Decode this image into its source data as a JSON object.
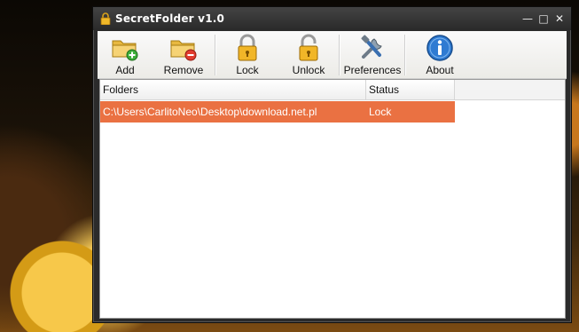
{
  "window": {
    "title": "SecretFolder v1.0",
    "controls": {
      "minimize": "—",
      "maximize": "□",
      "close": "✕"
    }
  },
  "toolbar": {
    "buttons": [
      {
        "label": "Add",
        "icon": "folder-add-icon"
      },
      {
        "label": "Remove",
        "icon": "folder-remove-icon"
      },
      {
        "label": "Lock",
        "icon": "lock-icon"
      },
      {
        "label": "Unlock",
        "icon": "unlock-icon"
      },
      {
        "label": "Preferences",
        "icon": "tools-icon"
      },
      {
        "label": "About",
        "icon": "info-icon"
      }
    ]
  },
  "list": {
    "columns": [
      "Folders",
      "Status"
    ],
    "rows": [
      {
        "folder": "C:\\Users\\CarlitoNeo\\Desktop\\download.net.pl",
        "status": "Lock"
      }
    ]
  },
  "colors": {
    "selected_row": "#ea7142",
    "titlebar": "#2b2b2b"
  }
}
